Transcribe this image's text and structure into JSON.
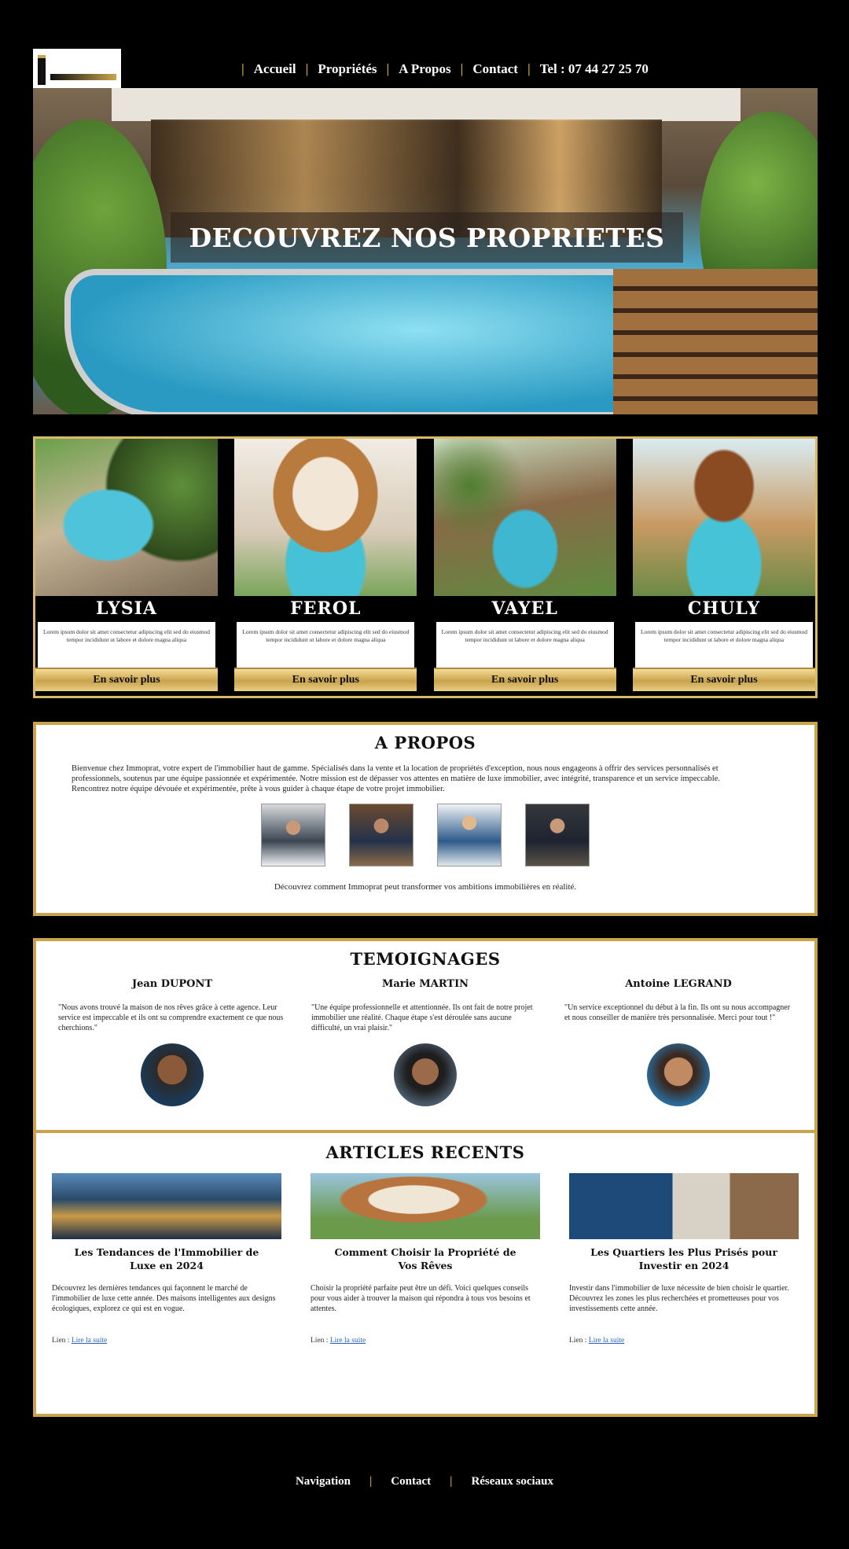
{
  "header": {
    "nav": [
      {
        "label": "Accueil"
      },
      {
        "label": "Propriétés"
      },
      {
        "label": "A Propos"
      },
      {
        "label": "Contact"
      },
      {
        "label": "Tel : 07 44 27 25 70"
      }
    ]
  },
  "hero": {
    "title": "DECOUVREZ NOS PROPRIETES"
  },
  "properties": [
    {
      "name": "LYSIA",
      "description": "Lorem ipsum dolor sit amet consectetur adipiscing elit sed do eiusmod tempor incididunt ut labore et dolore magna aliqua",
      "button": "En savoir plus"
    },
    {
      "name": "FEROL",
      "description": "Lorem ipsum dolor sit amet consectetur adipiscing elit sed do eiusmod tempor incididunt ut labore et dolore magna aliqua",
      "button": "En savoir plus"
    },
    {
      "name": "VAYEL",
      "description": "Lorem ipsum dolor sit amet consectetur adipiscing elit sed do eiusmod tempor incididunt ut labore et dolore magna aliqua",
      "button": "En savoir plus"
    },
    {
      "name": "CHULY",
      "description": "Lorem ipsum dolor sit amet consectetur adipiscing elit sed do eiusmod tempor incididunt ut labore et dolore magna aliqua",
      "button": "En savoir plus"
    }
  ],
  "about": {
    "title": "A PROPOS",
    "text": "Bienvenue chez Immoprat, votre expert de l'immobilier haut de gamme. Spécialisés dans la vente et la location de propriétés d'exception, nous nous engageons à offrir des services personnalisés et professionnels, soutenus par une équipe passionnée et expérimentée. Notre mission est de dépasser vos attentes en matière de luxe immobilier, avec intégrité, transparence et un service impeccable. Rencontrez notre équipe dévouée et expérimentée, prête à vous guider à chaque étape de votre projet immobilier.",
    "tagline": "Découvrez comment Immoprat peut transformer vos ambitions immobilières en réalité."
  },
  "testimonials": {
    "title": "TEMOIGNAGES",
    "items": [
      {
        "name": "Jean DUPONT",
        "quote": "\"Nous avons trouvé la maison de nos rêves grâce à cette agence. Leur service est impeccable et ils ont su comprendre exactement ce que nous cherchions.\""
      },
      {
        "name": "Marie MARTIN",
        "quote": "\"Une équipe professionnelle et attentionnée. Ils ont fait de notre projet immobilier une réalité. Chaque étape s'est déroulée sans aucune difficulté, un vrai plaisir.\""
      },
      {
        "name": "Antoine LEGRAND",
        "quote": "\"Un service exceptionnel du début à la fin. Ils ont su nous accompagner et nous conseiller de manière très personnalisée. Merci pour tout !\""
      }
    ]
  },
  "articles": {
    "title": "ARTICLES RECENTS",
    "items": [
      {
        "title": "Les Tendances de l'Immobilier de Luxe en 2024",
        "excerpt": "Découvrez les dernières tendances qui façonnent le marché de l'immobilier de luxe cette année. Des maisons intelligentes aux designs écologiques, explorez ce qui est en vogue.",
        "more_prefix": "Lien :",
        "more_link": "Lire la suite"
      },
      {
        "title": "Comment Choisir la Propriété de Vos Rêves",
        "excerpt": "Choisir la propriété parfaite peut être un défi. Voici quelques conseils pour vous aider à trouver la maison qui répondra à tous vos besoins et attentes.",
        "more_prefix": "Lien :",
        "more_link": "Lire la suite"
      },
      {
        "title": "Les Quartiers les Plus Prisés pour Investir en 2024",
        "excerpt": "Investir dans l'immobilier de luxe nécessite de bien choisir le quartier. Découvrez les zones les plus recherchées et prometteuses pour vos investissements cette année.",
        "more_prefix": "Lien :",
        "more_link": "Lire la suite"
      }
    ]
  },
  "footer": {
    "links": [
      {
        "label": "Navigation"
      },
      {
        "label": "Contact"
      },
      {
        "label": "Réseaux sociaux"
      }
    ]
  }
}
